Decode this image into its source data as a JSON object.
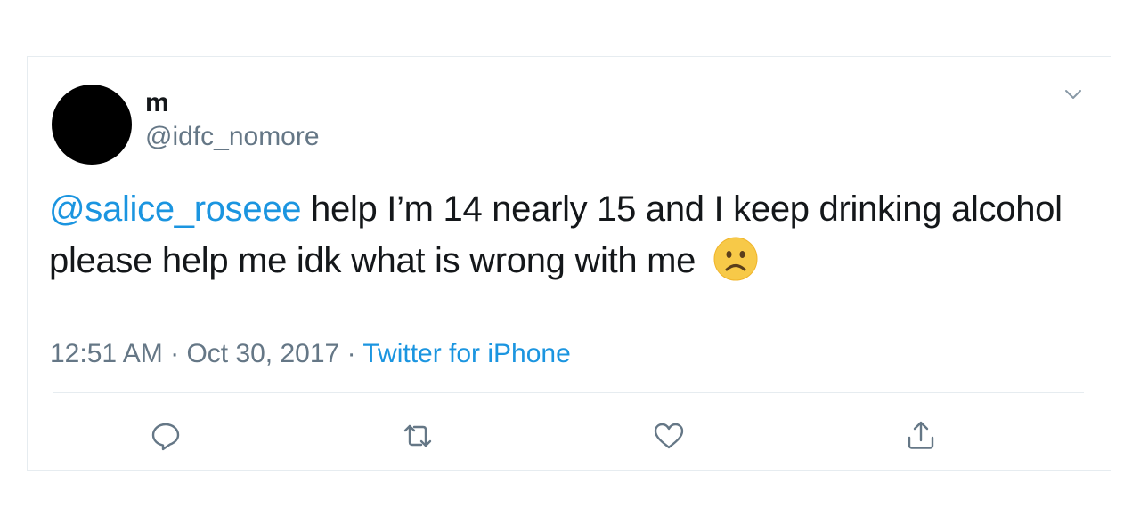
{
  "tweet": {
    "display_name": "m",
    "handle": "@idfc_nomore",
    "mention": "@salice_roseee",
    "body_text": " help I’m 14 nearly 15 and I keep drinking alcohol please help me idk what is wrong with me",
    "emoji": "frowning-face",
    "time": "12:51 AM",
    "date": "Oct 30, 2017",
    "source": "Twitter for iPhone",
    "separator": " · "
  },
  "actions": [
    "reply",
    "retweet",
    "like",
    "share"
  ],
  "colors": {
    "text": "#14171a",
    "muted": "#657786",
    "link": "#1b95e0",
    "border": "#e6ecf0",
    "emoji_face": "#f7c948"
  },
  "icons": {
    "menu": "chevron-down-icon",
    "reply": "reply-icon",
    "retweet": "retweet-icon",
    "like": "heart-icon",
    "share": "share-icon"
  }
}
